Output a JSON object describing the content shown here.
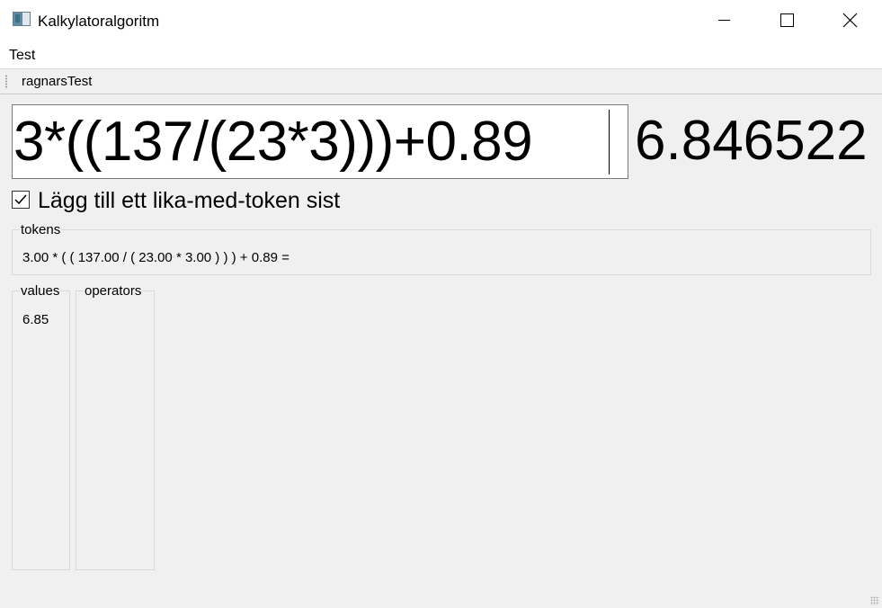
{
  "window": {
    "title": "Kalkylatoralgoritm",
    "icon": "app-window-icon",
    "controls": [
      "minimize-icon",
      "maximize-icon",
      "close-icon"
    ]
  },
  "menu": {
    "items": [
      "Test"
    ]
  },
  "toolbar": {
    "items": [
      "ragnarsTest"
    ]
  },
  "calculator": {
    "expression": "3*((137/(23*3)))+0.89",
    "result": "6.846522"
  },
  "option": {
    "label": "Lägg till ett lika-med-token sist",
    "checked": true
  },
  "tokens": {
    "title": "tokens",
    "content": "3.00 * ( ( 137.00 / ( 23.00 * 3.00 ) ) ) + 0.89 ="
  },
  "values": {
    "title": "values",
    "items": [
      "6.85"
    ]
  },
  "operators": {
    "title": "operators",
    "items": []
  }
}
